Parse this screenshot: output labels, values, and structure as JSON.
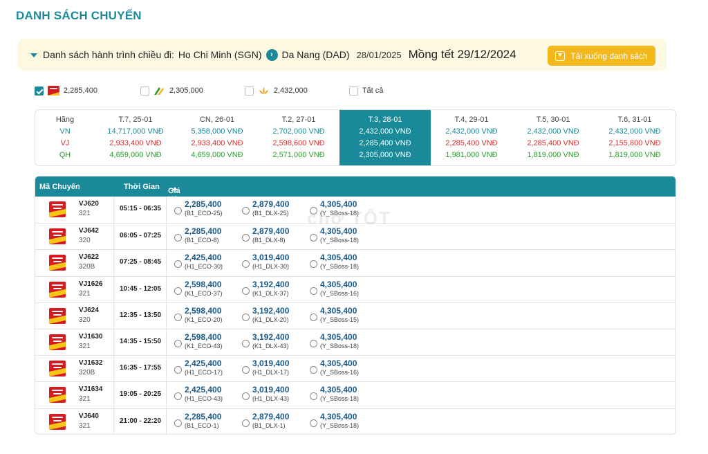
{
  "page_title": "DANH SÁCH CHUYẾN",
  "route": {
    "label": "Danh sách hành trình chiều đi:",
    "origin": "Ho Chi Minh (SGN)",
    "destination": "Da Nang (DAD)",
    "date": "28/01/2025",
    "note": "Mồng tết 29/12/2024",
    "download_label": "Tải xuống danh sách"
  },
  "filters": [
    {
      "price": "2,285,400",
      "checked": true,
      "airline": "VJ"
    },
    {
      "price": "2,305,000",
      "checked": false,
      "airline": "QH"
    },
    {
      "price": "2,432,000",
      "checked": false,
      "airline": "VN"
    },
    {
      "label": "Tất cả",
      "checked": false
    }
  ],
  "week": {
    "row_header": {
      "hd": "Hãng",
      "vn": "VN",
      "vj": "VJ",
      "qh": "QH"
    },
    "days": [
      {
        "day": "T.7, 25-01",
        "vn": "14,717,000 VNĐ",
        "vj": "2,933,400 VNĐ",
        "qh": "4,659,000 VNĐ",
        "active": false
      },
      {
        "day": "CN, 26-01",
        "vn": "5,358,000 VNĐ",
        "vj": "2,933,400 VNĐ",
        "qh": "4,659,000 VNĐ",
        "active": false
      },
      {
        "day": "T.2, 27-01",
        "vn": "2,702,000 VNĐ",
        "vj": "2,598,600 VNĐ",
        "qh": "2,571,000 VNĐ",
        "active": false
      },
      {
        "day": "T.3, 28-01",
        "vn": "2,432,000 VNĐ",
        "vj": "2,285,400 VNĐ",
        "qh": "2,305,000 VNĐ",
        "active": true
      },
      {
        "day": "T.4, 29-01",
        "vn": "2,432,000 VNĐ",
        "vj": "2,285,400 VNĐ",
        "qh": "1,981,000 VNĐ",
        "active": false
      },
      {
        "day": "T.5, 30-01",
        "vn": "2,432,000 VNĐ",
        "vj": "2,285,400 VNĐ",
        "qh": "1,819,000 VNĐ",
        "active": false
      },
      {
        "day": "T.6, 31-01",
        "vn": "2,432,000 VNĐ",
        "vj": "2,155,800 VNĐ",
        "qh": "1,819,000 VNĐ",
        "active": false
      }
    ]
  },
  "table": {
    "headers": {
      "code": "Mã Chuyến",
      "time": "Thời Gian",
      "price": "Giá Vé"
    },
    "rows": [
      {
        "code": "VJ620",
        "aircraft": "321",
        "time": "05:15 - 06:35",
        "fares": [
          {
            "price": "2,285,400",
            "code": "(B1_ECO-25)"
          },
          {
            "price": "2,879,400",
            "code": "(B1_DLX-25)"
          },
          {
            "price": "4,305,400",
            "code": "(Y_SBoss-18)"
          }
        ]
      },
      {
        "code": "VJ642",
        "aircraft": "320",
        "time": "06:05 - 07:25",
        "fares": [
          {
            "price": "2,285,400",
            "code": "(B1_ECO-8)"
          },
          {
            "price": "2,879,400",
            "code": "(B1_DLX-8)"
          },
          {
            "price": "4,305,400",
            "code": "(Y_SBoss-18)"
          }
        ]
      },
      {
        "code": "VJ622",
        "aircraft": "320B",
        "time": "07:25 - 08:45",
        "fares": [
          {
            "price": "2,425,400",
            "code": "(H1_ECO-30)"
          },
          {
            "price": "3,019,400",
            "code": "(H1_DLX-30)"
          },
          {
            "price": "4,305,400",
            "code": "(Y_SBoss-18)"
          }
        ]
      },
      {
        "code": "VJ1626",
        "aircraft": "321",
        "time": "10:45 - 12:05",
        "fares": [
          {
            "price": "2,598,400",
            "code": "(K1_ECO-37)"
          },
          {
            "price": "3,192,400",
            "code": "(K1_DLX-37)"
          },
          {
            "price": "4,305,400",
            "code": "(Y_SBoss-16)"
          }
        ]
      },
      {
        "code": "VJ624",
        "aircraft": "320",
        "time": "12:35 - 13:50",
        "fares": [
          {
            "price": "2,598,400",
            "code": "(K1_ECO-20)"
          },
          {
            "price": "3,192,400",
            "code": "(K1_DLX-20)"
          },
          {
            "price": "4,305,400",
            "code": "(Y_SBoss-15)"
          }
        ]
      },
      {
        "code": "VJ1630",
        "aircraft": "321",
        "time": "14:35 - 15:50",
        "fares": [
          {
            "price": "2,598,400",
            "code": "(K1_ECO-43)"
          },
          {
            "price": "3,192,400",
            "code": "(K1_DLX-43)"
          },
          {
            "price": "4,305,400",
            "code": "(Y_SBoss-18)"
          }
        ]
      },
      {
        "code": "VJ1632",
        "aircraft": "320B",
        "time": "16:35 - 17:55",
        "fares": [
          {
            "price": "2,425,400",
            "code": "(H1_ECO-17)"
          },
          {
            "price": "3,019,400",
            "code": "(H1_DLX-17)"
          },
          {
            "price": "4,305,400",
            "code": "(Y_SBoss-16)"
          }
        ]
      },
      {
        "code": "VJ1634",
        "aircraft": "321",
        "time": "19:05 - 20:25",
        "fares": [
          {
            "price": "2,425,400",
            "code": "(H1_ECO-43)"
          },
          {
            "price": "3,019,400",
            "code": "(H1_DLX-43)"
          },
          {
            "price": "4,305,400",
            "code": "(Y_SBoss-18)"
          }
        ]
      },
      {
        "code": "VJ640",
        "aircraft": "321",
        "time": "21:00 - 22:20",
        "fares": [
          {
            "price": "2,285,400",
            "code": "(B1_ECO-1)"
          },
          {
            "price": "2,879,400",
            "code": "(B1_DLX-1)"
          },
          {
            "price": "4,305,400",
            "code": "(Y_SBoss-18)"
          }
        ]
      }
    ]
  },
  "watermark": "chợ TỐT",
  "colors": {
    "teal": "#1a8a9a",
    "vj_red": "#d0312d",
    "qh_green": "#2d9a2d",
    "gold": "#f3b81b"
  }
}
